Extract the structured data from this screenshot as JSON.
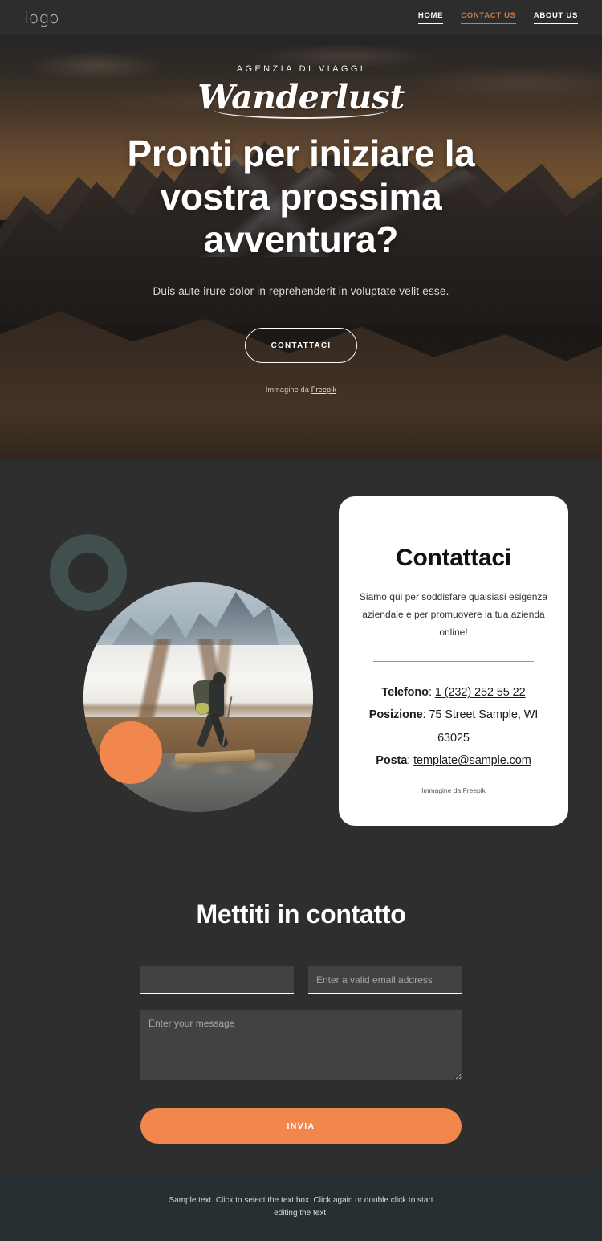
{
  "header": {
    "logo": "logo",
    "nav": [
      {
        "label": "HOME",
        "active": false
      },
      {
        "label": "CONTACT US",
        "active": true
      },
      {
        "label": "ABOUT US",
        "active": false
      }
    ]
  },
  "hero": {
    "eyebrow": "AGENZIA DI VIAGGI",
    "wordmark": "Wanderlust",
    "title": "Pronti per iniziare la vostra prossima avventura?",
    "subtitle": "Duis aute irure dolor in reprehenderit in voluptate velit esse.",
    "cta": "CONTATTACI",
    "credit_prefix": "Immagine da",
    "credit_link": "Freepik"
  },
  "contact_card": {
    "title": "Contattaci",
    "description": "Siamo qui per soddisfare qualsiasi esigenza aziendale e per promuovere la tua azienda online!",
    "phone_label": "Telefono",
    "phone_value": "1 (232) 252 55 22",
    "location_label": "Posizione",
    "location_value": "75 Street Sample, WI 63025",
    "mail_label": "Posta",
    "mail_value": "template@sample.com",
    "credit_prefix": "Immagine da",
    "credit_link": "Freepik"
  },
  "decor": {
    "ring_color": "#41504f",
    "dot_color": "#f2874d",
    "photo_alt": "hiker-crossing-stream"
  },
  "form": {
    "title": "Mettiti in contatto",
    "name_placeholder": "",
    "name_value": "",
    "email_placeholder": "Enter a valid email address",
    "email_value": "",
    "message_placeholder": "Enter your message",
    "message_value": "",
    "submit_label": "INVIA"
  },
  "footer": {
    "text": "Sample text. Click to select the text box. Click again or double click to start editing the text."
  },
  "colors": {
    "accent_orange": "#f2874d",
    "nav_active": "#d2784a",
    "divider": "#c9895c",
    "page_bg": "#2f2e2e",
    "footer_bg": "#272f33"
  }
}
